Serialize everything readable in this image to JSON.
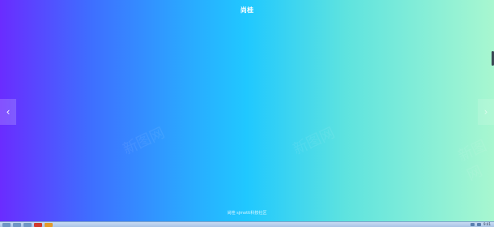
{
  "page": {
    "title": "尚桂",
    "footer": "尚桂 sjmotti科技社区"
  },
  "watermarks": [
    "新图网",
    "新图网",
    "新图网"
  ],
  "nav": {
    "prev_glyph": "‹",
    "next_glyph": "›"
  },
  "taskbar": {
    "clock": "9:41"
  },
  "colors": {
    "gradient_left": "#6a2cff",
    "gradient_mid": "#20c8ff",
    "gradient_right": "#a8f7d0"
  },
  "icons": {
    "prev": "chevron-left-icon",
    "next": "chevron-right-icon"
  }
}
